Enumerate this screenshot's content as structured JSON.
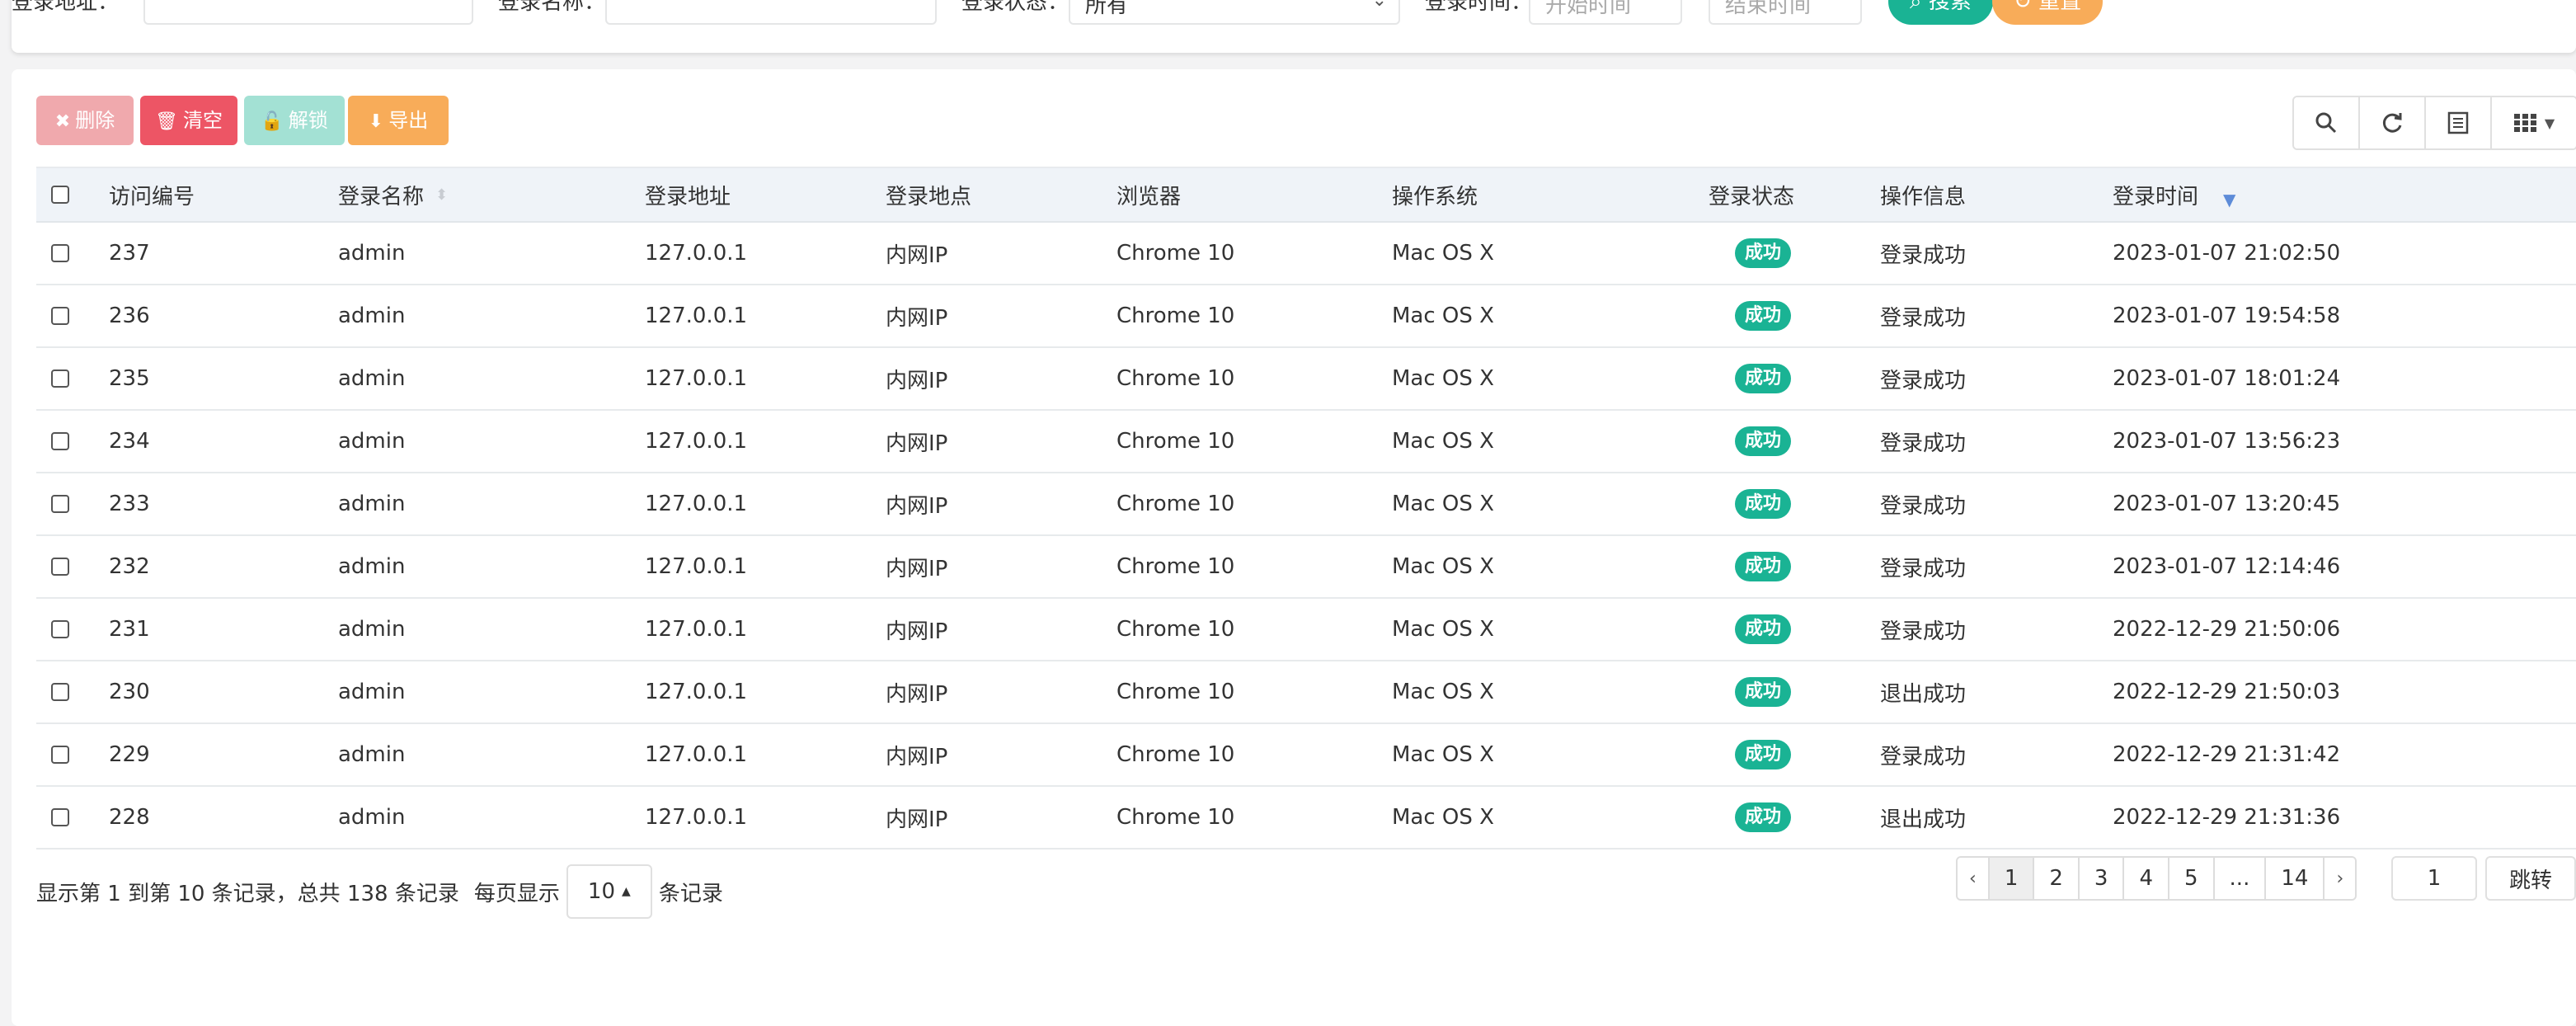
{
  "search": {
    "login_address_label": "登录地址：",
    "login_name_label": "登录名称：",
    "status_label": "登录状态：",
    "status_value": "所有",
    "time_label": "登录时间：",
    "start_time_placeholder": "开始时间",
    "separator": "-",
    "end_time_placeholder": "结束时间",
    "search_button": "搜索",
    "reset_button": "重置"
  },
  "toolbar": {
    "delete_label": "删除",
    "clear_label": "清空",
    "unlock_label": "解锁",
    "export_label": "导出"
  },
  "tools": {
    "icons": [
      "search-icon",
      "refresh-icon",
      "toggle-view-icon",
      "columns-icon"
    ]
  },
  "table": {
    "headers": {
      "id": "访问编号",
      "login_name": "登录名称",
      "address": "登录地址",
      "location": "登录地点",
      "browser": "浏览器",
      "os": "操作系统",
      "status": "登录状态",
      "message": "操作信息",
      "time": "登录时间"
    },
    "rows": [
      {
        "id": "237",
        "login_name": "admin",
        "address": "127.0.0.1",
        "location": "内网IP",
        "browser": "Chrome 10",
        "os": "Mac OS X",
        "status": "成功",
        "message": "登录成功",
        "time": "2023-01-07 21:02:50"
      },
      {
        "id": "236",
        "login_name": "admin",
        "address": "127.0.0.1",
        "location": "内网IP",
        "browser": "Chrome 10",
        "os": "Mac OS X",
        "status": "成功",
        "message": "登录成功",
        "time": "2023-01-07 19:54:58"
      },
      {
        "id": "235",
        "login_name": "admin",
        "address": "127.0.0.1",
        "location": "内网IP",
        "browser": "Chrome 10",
        "os": "Mac OS X",
        "status": "成功",
        "message": "登录成功",
        "time": "2023-01-07 18:01:24"
      },
      {
        "id": "234",
        "login_name": "admin",
        "address": "127.0.0.1",
        "location": "内网IP",
        "browser": "Chrome 10",
        "os": "Mac OS X",
        "status": "成功",
        "message": "登录成功",
        "time": "2023-01-07 13:56:23"
      },
      {
        "id": "233",
        "login_name": "admin",
        "address": "127.0.0.1",
        "location": "内网IP",
        "browser": "Chrome 10",
        "os": "Mac OS X",
        "status": "成功",
        "message": "登录成功",
        "time": "2023-01-07 13:20:45"
      },
      {
        "id": "232",
        "login_name": "admin",
        "address": "127.0.0.1",
        "location": "内网IP",
        "browser": "Chrome 10",
        "os": "Mac OS X",
        "status": "成功",
        "message": "登录成功",
        "time": "2023-01-07 12:14:46"
      },
      {
        "id": "231",
        "login_name": "admin",
        "address": "127.0.0.1",
        "location": "内网IP",
        "browser": "Chrome 10",
        "os": "Mac OS X",
        "status": "成功",
        "message": "登录成功",
        "time": "2022-12-29 21:50:06"
      },
      {
        "id": "230",
        "login_name": "admin",
        "address": "127.0.0.1",
        "location": "内网IP",
        "browser": "Chrome 10",
        "os": "Mac OS X",
        "status": "成功",
        "message": "退出成功",
        "time": "2022-12-29 21:50:03"
      },
      {
        "id": "229",
        "login_name": "admin",
        "address": "127.0.0.1",
        "location": "内网IP",
        "browser": "Chrome 10",
        "os": "Mac OS X",
        "status": "成功",
        "message": "登录成功",
        "time": "2022-12-29 21:31:42"
      },
      {
        "id": "228",
        "login_name": "admin",
        "address": "127.0.0.1",
        "location": "内网IP",
        "browser": "Chrome 10",
        "os": "Mac OS X",
        "status": "成功",
        "message": "退出成功",
        "time": "2022-12-29 21:31:36"
      }
    ]
  },
  "footer": {
    "info_text": "显示第 1 到第 10 条记录，总共 138 条记录",
    "per_page_prefix": "每页显示",
    "page_size": "10",
    "per_page_suffix": "条记录",
    "pages": [
      "‹",
      "1",
      "2",
      "3",
      "4",
      "5",
      "...",
      "14",
      "›"
    ],
    "current_page": "1",
    "jump_value": "1",
    "jump_button": "跳转"
  },
  "colors": {
    "primary": "#1ab394",
    "danger": "#ed5565",
    "warning": "#f8ac59",
    "header_bg": "#eff3f8"
  }
}
